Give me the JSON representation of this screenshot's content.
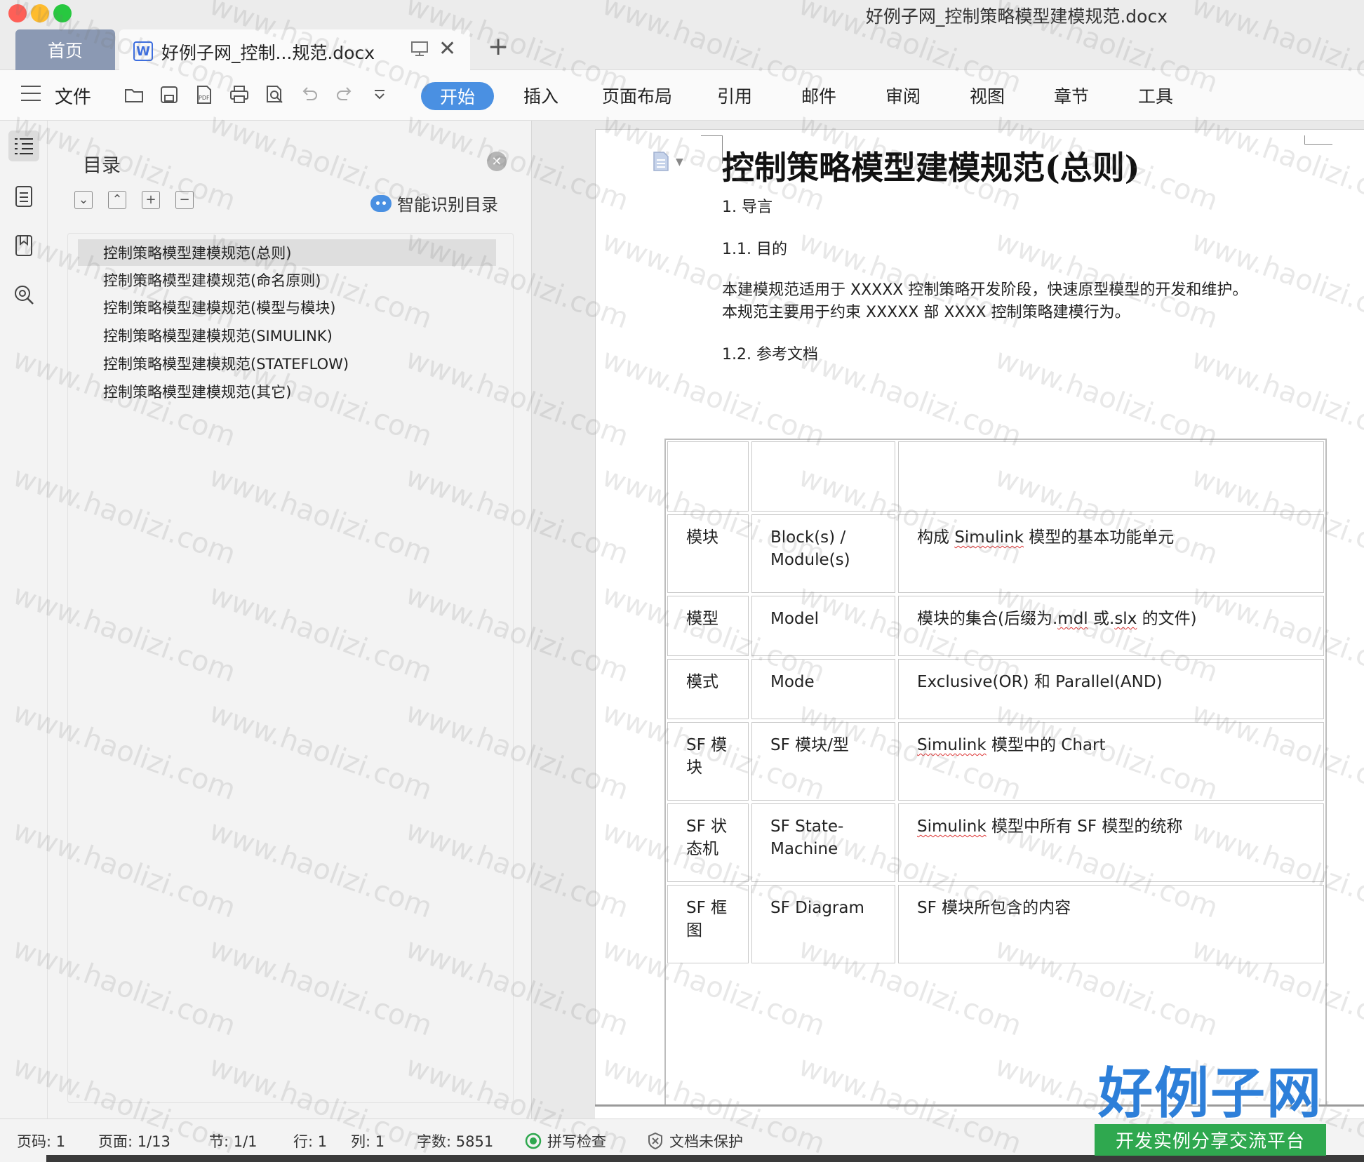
{
  "window": {
    "title": "好例子网_控制策略模型建模规范.docx"
  },
  "tabs": {
    "home": "首页",
    "doc": "好例子网_控制...规范.docx"
  },
  "toolbar": {
    "file": "文件",
    "ribbon": [
      "开始",
      "插入",
      "页面布局",
      "引用",
      "邮件",
      "审阅",
      "视图",
      "章节",
      "工具"
    ]
  },
  "toc": {
    "title": "目录",
    "smart_label": "智能识别目录",
    "items": [
      "控制策略模型建模规范(总则)",
      "控制策略模型建模规范(命名原则)",
      "控制策略模型建模规范(模型与模块)",
      "控制策略模型建模规范(SIMULINK)",
      "控制策略模型建模规范(STATEFLOW)",
      "控制策略模型建模规范(其它)"
    ]
  },
  "document": {
    "heading": "控制策略模型建模规范(总则)",
    "sec1": "1. 导言",
    "sec11": "1.1. 目的",
    "body1": "本建模规范适用于 XXXXX 控制策略开发阶段，快速原型模型的开发和维护。",
    "body2": "本规范主要用于约束 XXXXX 部 XXXX 控制策略建模行为。",
    "sec12": "1.2. 参考文档",
    "table": {
      "rows": [
        {
          "c1": "",
          "c2": "",
          "c3": ""
        },
        {
          "c1": "模块",
          "c2a": "Block(s) /",
          "c2b": "Module(s)",
          "c3pre": "构成 ",
          "c3spell": "Simulink",
          "c3post": " 模型的基本功能单元"
        },
        {
          "c1": "模型",
          "c2": "Model",
          "c3pre": "模块的集合(后缀为.",
          "c3spell": "mdl",
          "c3mid": " 或.",
          "c3spell2": "slx",
          "c3post": " 的文件)"
        },
        {
          "c1": "模式",
          "c2": "Mode",
          "c3": "Exclusive(OR) 和 Parallel(AND)"
        },
        {
          "c1a": "SF 模",
          "c1b": "块",
          "c2": "SF 模块/型",
          "c3spell": "Simulink",
          "c3post": " 模型中的 Chart"
        },
        {
          "c1a": "SF 状",
          "c1b": "态机",
          "c2": "SF State-Machine",
          "c3spell": "Simulink",
          "c3post": " 模型中所有 SF 模型的统称"
        },
        {
          "c1a": "SF 框",
          "c1b": "图",
          "c2": "SF Diagram",
          "c3": "SF 模块所包含的内容"
        }
      ]
    }
  },
  "status": {
    "page_code": "页码: 1",
    "page": "页面: 1/13",
    "section": "节: 1/1",
    "row": "行: 1",
    "col": "列: 1",
    "words": "字数: 5851",
    "spell_check": "拼写检查",
    "protect": "文档未保护"
  },
  "watermark": {
    "text": "www.haolizi.com"
  },
  "brand": {
    "name": "好例子网",
    "tagline": "开发实例分享交流平台"
  },
  "colors": {
    "accent": "#4a90e2",
    "home_tab": "#8b99b3",
    "brand_blue": "#2d7fd9",
    "brand_green": "#2fa84f"
  }
}
